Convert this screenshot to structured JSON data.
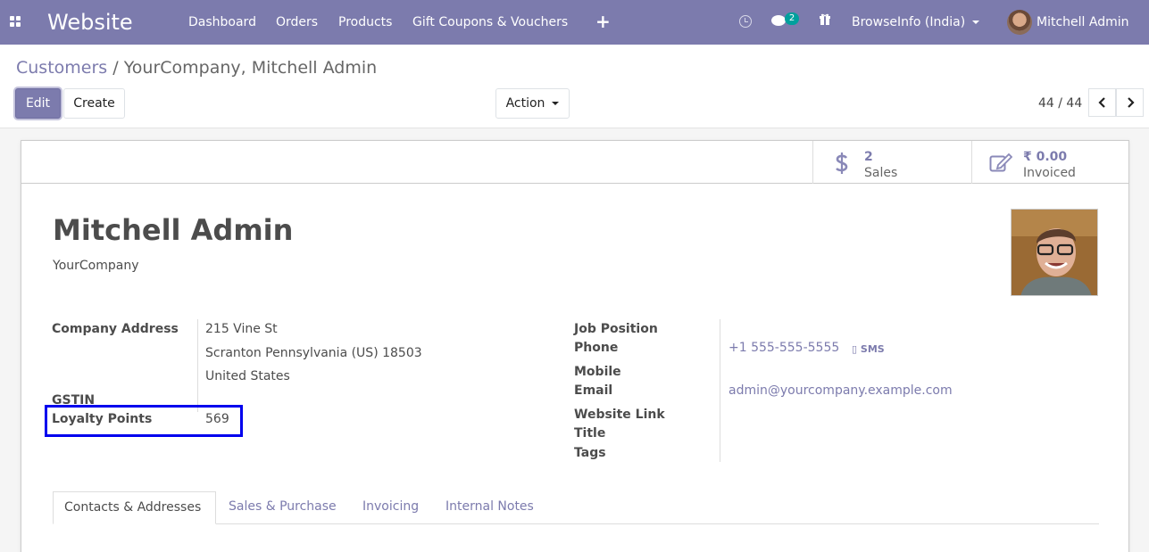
{
  "navbar": {
    "brand": "Website",
    "menu": [
      "Dashboard",
      "Orders",
      "Products",
      "Gift Coupons & Vouchers"
    ],
    "chat_badge": "2",
    "company": "BrowseInfo (India)",
    "user": "Mitchell Admin",
    "color": "#7c7bad"
  },
  "breadcrumb": {
    "parent": "Customers",
    "separator": "/",
    "current": "YourCompany, Mitchell Admin"
  },
  "toolbar": {
    "edit": "Edit",
    "create": "Create",
    "action": "Action",
    "pager": "44 / 44"
  },
  "smart_buttons": [
    {
      "value": "2",
      "label": "Sales",
      "icon": "dollar-icon"
    },
    {
      "value": "₹ 0.00",
      "label": "Invoiced",
      "icon": "edit-icon"
    }
  ],
  "partner": {
    "name": "Mitchell Admin",
    "parent": "YourCompany"
  },
  "left_fields": {
    "address_label": "Company Address",
    "street": "215 Vine St",
    "city_line": "Scranton  Pennsylvania (US)  18503",
    "country": "United States",
    "gstin_label": "GSTIN",
    "loyalty_label": "Loyalty Points",
    "loyalty_value": "569"
  },
  "right_fields": {
    "job_label": "Job Position",
    "phone_label": "Phone",
    "phone_value": "+1 555-555-5555",
    "sms": "SMS",
    "mobile_label": "Mobile",
    "email_label": "Email",
    "email_value": "admin@yourcompany.example.com",
    "website_label": "Website Link",
    "title_label": "Title",
    "tags_label": "Tags"
  },
  "tabs": [
    "Contacts & Addresses",
    "Sales & Purchase",
    "Invoicing",
    "Internal Notes"
  ],
  "highlight_color": "#0000ee"
}
